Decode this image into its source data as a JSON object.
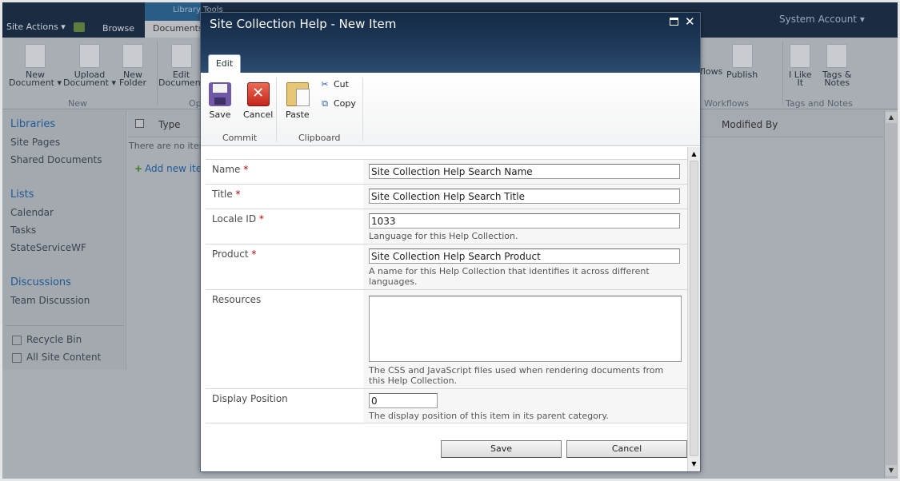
{
  "background": {
    "site_actions": "Site Actions ▾",
    "browse_tab": "Browse",
    "library_tools": "Library Tools",
    "documents_tab": "Documents",
    "system_account": "System Account ▾",
    "ribbon": {
      "new_document": "New\nDocument ▾",
      "upload_document": "Upload\nDocument ▾",
      "new_folder": "New\nFolder",
      "edit_document": "Edit\nDocument",
      "group_new": "New",
      "group_open": "Op",
      "workflows": "flows",
      "publish": "Publish",
      "i_like_it": "I Like\nIt",
      "tags_notes": "Tags &\nNotes",
      "group_workflows": "Workflows",
      "group_tags": "Tags and Notes"
    },
    "nav": {
      "libraries": "Libraries",
      "site_pages": "Site Pages",
      "shared_documents": "Shared Documents",
      "lists": "Lists",
      "calendar": "Calendar",
      "tasks": "Tasks",
      "stateservicewf": "StateServiceWF",
      "discussions": "Discussions",
      "team_discussion": "Team Discussion",
      "recycle_bin": "Recycle Bin",
      "all_site_content": "All Site Content"
    },
    "list": {
      "col_type": "Type",
      "col_modified_by": "Modified By",
      "no_items": "There are no items",
      "add_new": "Add new ite"
    }
  },
  "dialog": {
    "title": "Site Collection Help - New Item",
    "tab_edit": "Edit",
    "ribbon": {
      "save": "Save",
      "cancel": "Cancel",
      "paste": "Paste",
      "cut": "Cut",
      "copy": "Copy",
      "group_commit": "Commit",
      "group_clipboard": "Clipboard"
    },
    "form": {
      "name_label": "Name",
      "name_value": "Site Collection Help Search Name",
      "title_label": "Title",
      "title_value": "Site Collection Help Search Title",
      "locale_label": "Locale ID",
      "locale_value": "1033",
      "locale_desc": "Language for this Help Collection.",
      "product_label": "Product",
      "product_value": "Site Collection Help Search Product",
      "product_desc": "A name for this Help Collection that identifies it across different languages.",
      "resources_label": "Resources",
      "resources_value": "",
      "resources_desc": "The CSS and JavaScript files used when rendering documents from this Help Collection.",
      "display_position_label": "Display Position",
      "display_position_value": "0",
      "display_position_desc": "The display position of this item in its parent category.",
      "required_marker": "*"
    },
    "buttons": {
      "save": "Save",
      "cancel": "Cancel"
    }
  },
  "colors": {
    "title_bar": "#1f3b5c",
    "required": "#bb0000",
    "nav_heading": "#1f5a94"
  }
}
